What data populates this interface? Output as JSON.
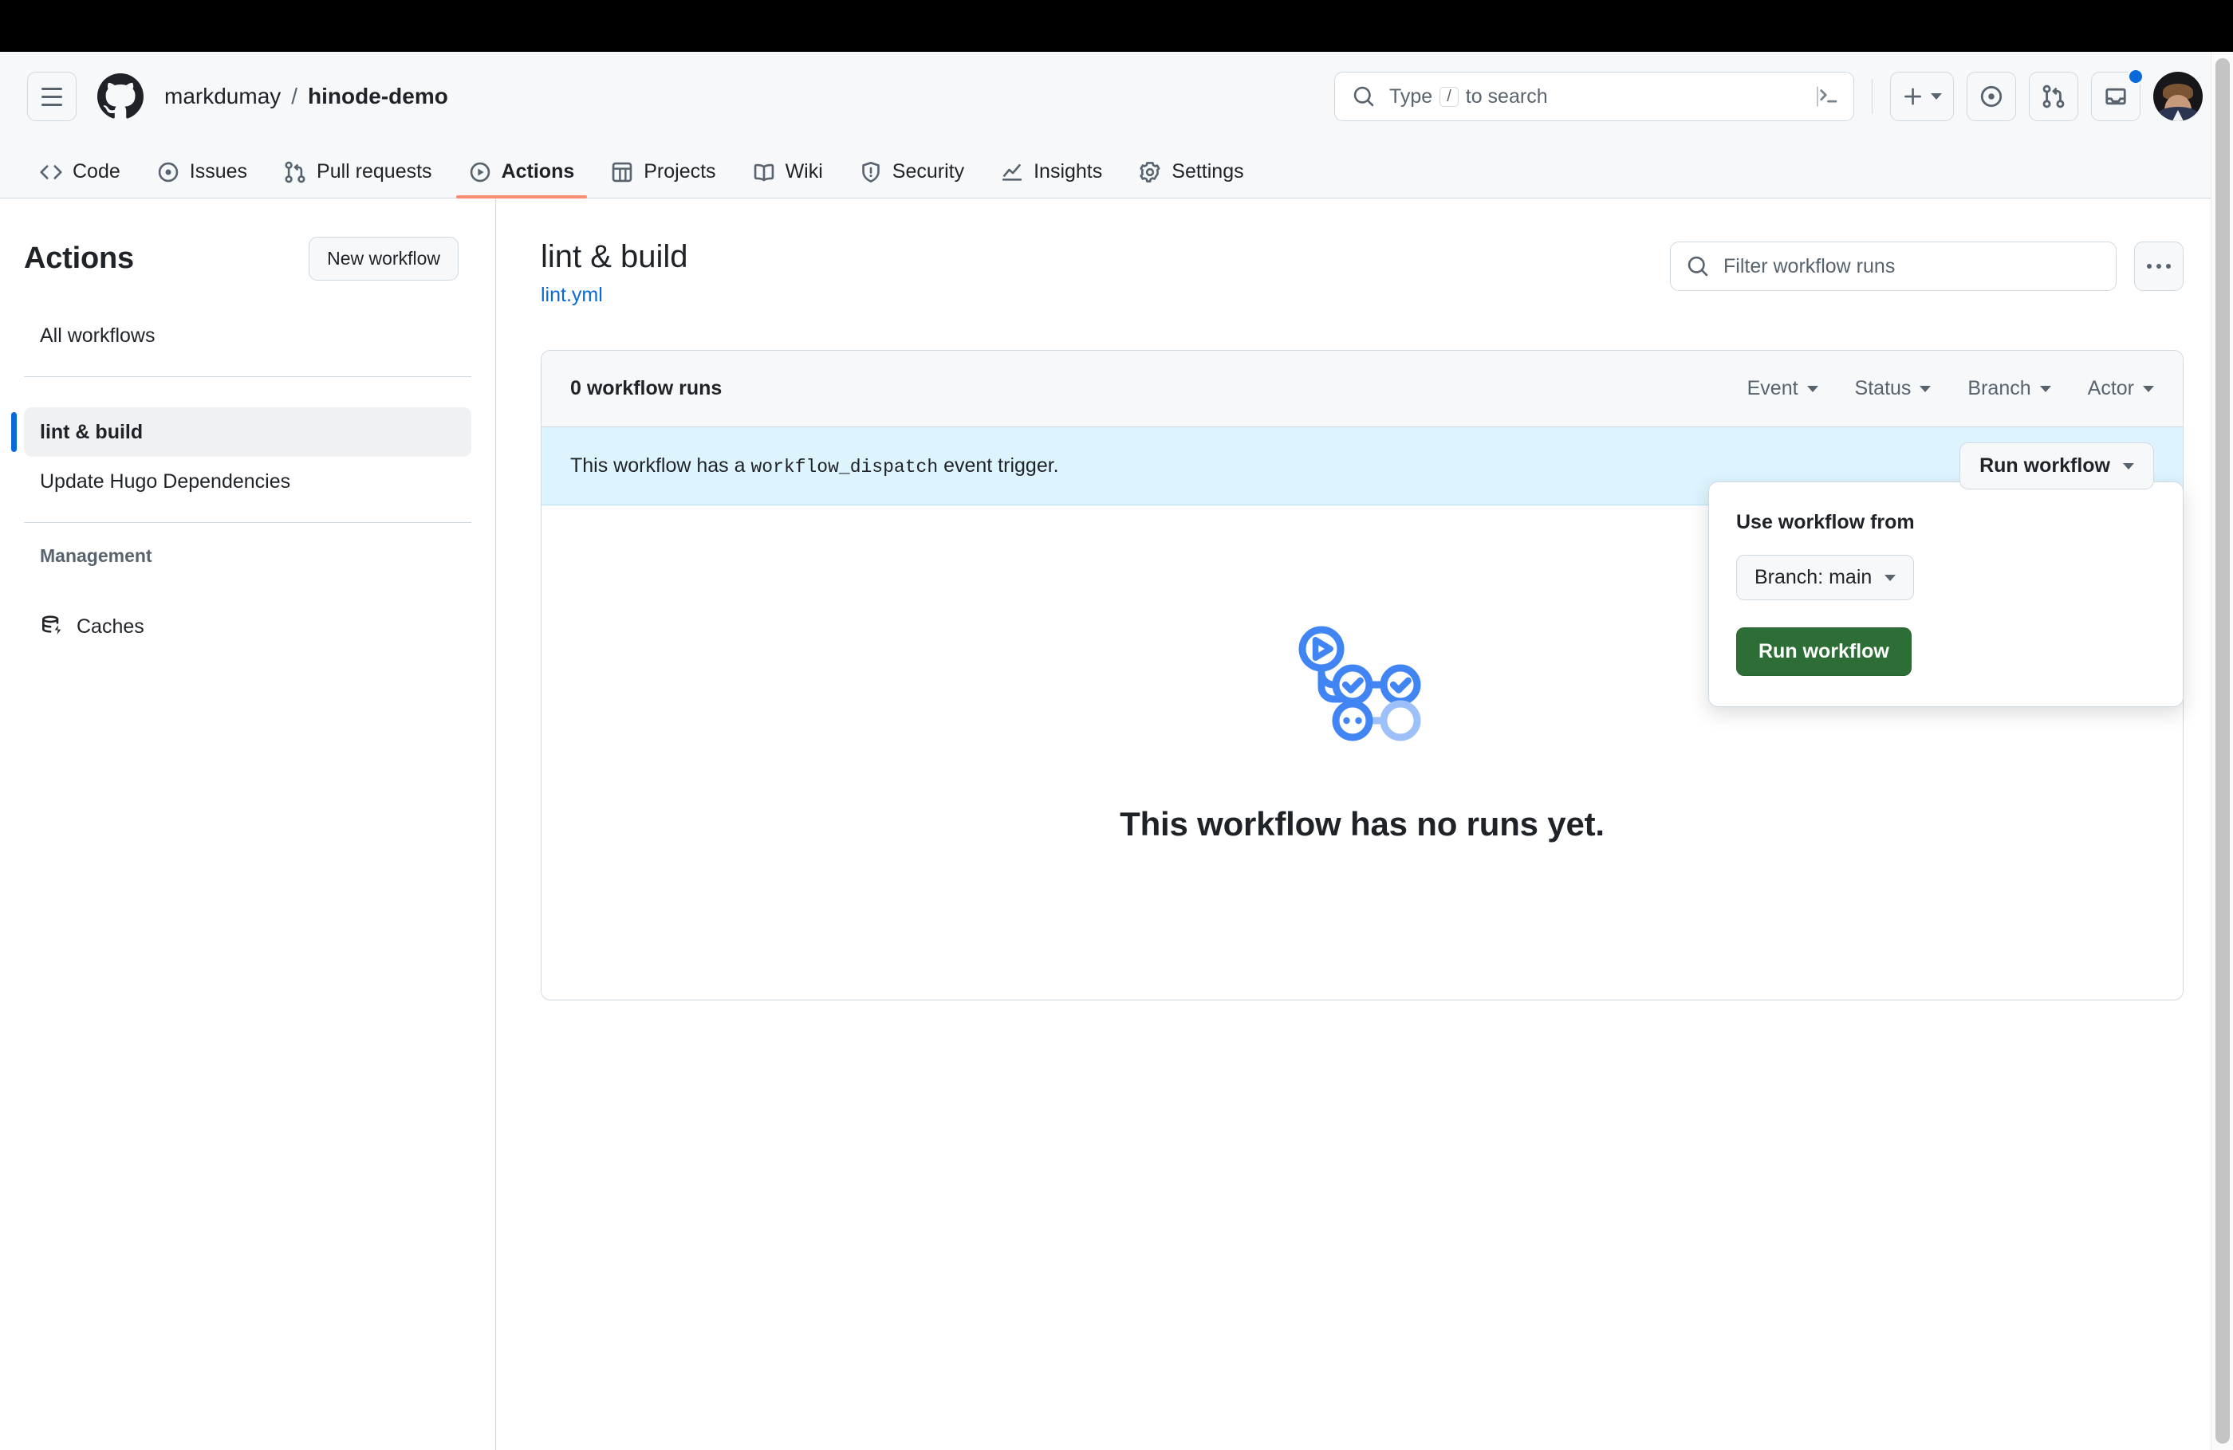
{
  "window": {
    "chrome_bar_color": "#000000"
  },
  "header": {
    "hamburger_label": "Open navigation menu",
    "logo_icon": "github-mark-icon",
    "breadcrumb": {
      "owner": "markdumay",
      "separator": "/",
      "repo": "hinode-demo"
    },
    "search": {
      "icon": "search-icon",
      "placeholder_prefix": "Type",
      "placeholder_key": "/",
      "placeholder_suffix": "to search",
      "terminal_icon": "command-palette-icon"
    },
    "actions": [
      {
        "name": "create-new-button",
        "icon": "plus-icon",
        "has_caret": true
      },
      {
        "name": "issues-button",
        "icon": "issue-opened-icon",
        "has_caret": false
      },
      {
        "name": "pull-requests-button",
        "icon": "git-pull-request-icon",
        "has_caret": false
      },
      {
        "name": "notifications-button",
        "icon": "inbox-icon",
        "has_caret": false,
        "has_dot": true
      }
    ],
    "avatar_label": "User avatar",
    "notification_dot_color": "#0969da"
  },
  "repo_nav": {
    "active_underline_color": "#fd8c73",
    "tabs": [
      {
        "label": "Code",
        "icon": "code-icon",
        "active": false
      },
      {
        "label": "Issues",
        "icon": "issue-opened-icon",
        "active": false
      },
      {
        "label": "Pull requests",
        "icon": "git-pull-request-icon",
        "active": false
      },
      {
        "label": "Actions",
        "icon": "play-icon",
        "active": true
      },
      {
        "label": "Projects",
        "icon": "table-icon",
        "active": false
      },
      {
        "label": "Wiki",
        "icon": "book-icon",
        "active": false
      },
      {
        "label": "Security",
        "icon": "shield-icon",
        "active": false
      },
      {
        "label": "Insights",
        "icon": "graph-icon",
        "active": false
      },
      {
        "label": "Settings",
        "icon": "gear-icon",
        "active": false
      }
    ]
  },
  "sidebar": {
    "title": "Actions",
    "new_workflow_label": "New workflow",
    "all_workflows_label": "All workflows",
    "workflows": [
      {
        "label": "lint & build",
        "selected": true
      },
      {
        "label": "Update Hugo Dependencies",
        "selected": false
      }
    ],
    "management_label": "Management",
    "management_items": [
      {
        "label": "Caches",
        "icon": "cache-database-icon"
      }
    ],
    "selected_indicator_color": "#0969da"
  },
  "main": {
    "workflow_title": "lint & build",
    "workflow_file": "lint.yml",
    "filter": {
      "icon": "search-icon",
      "placeholder": "Filter workflow runs"
    },
    "kebab_label": "More options",
    "runs": {
      "count_label": "0 workflow runs",
      "filters": [
        {
          "label": "Event"
        },
        {
          "label": "Status"
        },
        {
          "label": "Branch"
        },
        {
          "label": "Actor"
        }
      ]
    },
    "dispatch_banner": {
      "text_before": "This workflow has a",
      "code": "workflow_dispatch",
      "text_after": "event trigger.",
      "run_button_label": "Run workflow",
      "background_color": "#ddf4ff"
    },
    "dispatch_popover": {
      "title": "Use workflow from",
      "branch_label": "Branch: main",
      "submit_label": "Run workflow",
      "submit_color": "#2c6e35"
    },
    "empty_state": {
      "illustration": "workflow-graph-illustration",
      "message": "This workflow has no runs yet."
    }
  },
  "scrollbar": {
    "name": "page-scrollbar",
    "thumb_color": "#c4c4c4"
  }
}
